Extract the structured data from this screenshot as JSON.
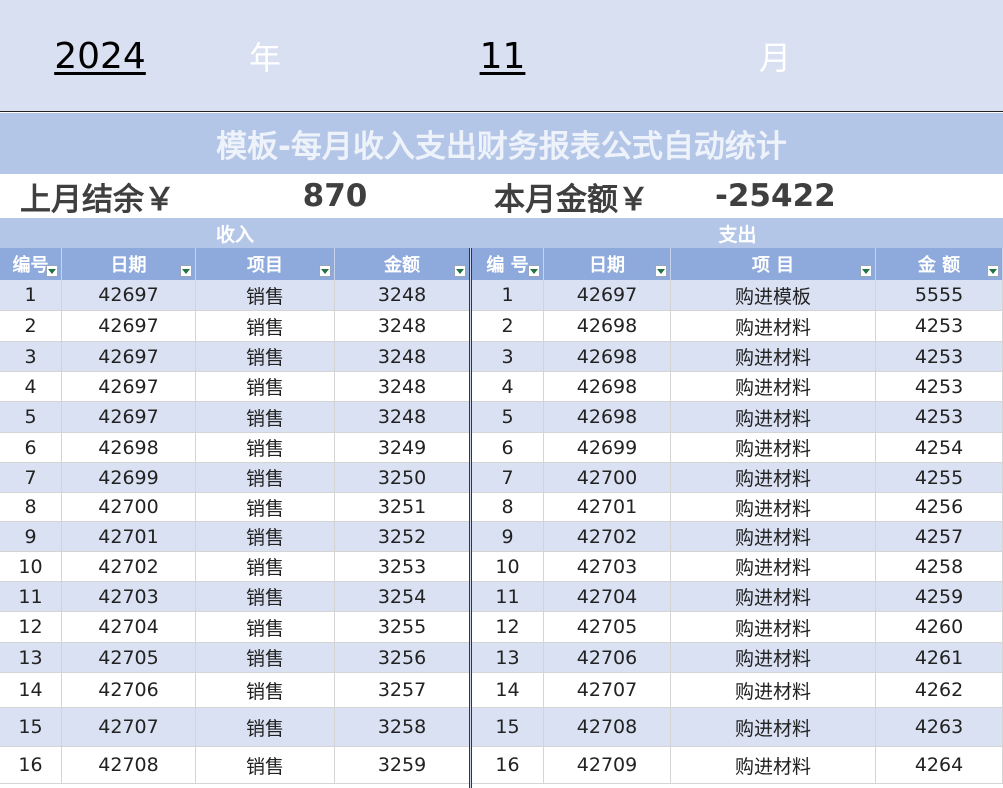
{
  "header": {
    "year": "2024",
    "year_label": "年",
    "month": "11",
    "month_label": "月"
  },
  "title": "模板-每月收入支出财务报表公式自动统计",
  "summary": {
    "last_balance_label": "上月结余￥",
    "last_balance_value": "870",
    "this_month_label": "本月金额￥",
    "this_month_value": "-25422"
  },
  "income": {
    "title": "收入",
    "headers": [
      "编号",
      "日期",
      "项目",
      "金额"
    ],
    "rows": [
      [
        "1",
        "42697",
        "销售",
        "3248"
      ],
      [
        "2",
        "42697",
        "销售",
        "3248"
      ],
      [
        "3",
        "42697",
        "销售",
        "3248"
      ],
      [
        "4",
        "42697",
        "销售",
        "3248"
      ],
      [
        "5",
        "42697",
        "销售",
        "3248"
      ],
      [
        "6",
        "42698",
        "销售",
        "3249"
      ],
      [
        "7",
        "42699",
        "销售",
        "3250"
      ],
      [
        "8",
        "42700",
        "销售",
        "3251"
      ],
      [
        "9",
        "42701",
        "销售",
        "3252"
      ],
      [
        "10",
        "42702",
        "销售",
        "3253"
      ],
      [
        "11",
        "42703",
        "销售",
        "3254"
      ],
      [
        "12",
        "42704",
        "销售",
        "3255"
      ],
      [
        "13",
        "42705",
        "销售",
        "3256"
      ],
      [
        "14",
        "42706",
        "销售",
        "3257"
      ],
      [
        "15",
        "42707",
        "销售",
        "3258"
      ],
      [
        "16",
        "42708",
        "销售",
        "3259"
      ]
    ]
  },
  "expense": {
    "title": "支出",
    "headers": [
      "编 号",
      "日期",
      "项 目",
      "金 额"
    ],
    "rows": [
      [
        "1",
        "42697",
        "购进模板",
        "5555"
      ],
      [
        "2",
        "42698",
        "购进材料",
        "4253"
      ],
      [
        "3",
        "42698",
        "购进材料",
        "4253"
      ],
      [
        "4",
        "42698",
        "购进材料",
        "4253"
      ],
      [
        "5",
        "42698",
        "购进材料",
        "4253"
      ],
      [
        "6",
        "42699",
        "购进材料",
        "4254"
      ],
      [
        "7",
        "42700",
        "购进材料",
        "4255"
      ],
      [
        "8",
        "42701",
        "购进材料",
        "4256"
      ],
      [
        "9",
        "42702",
        "购进材料",
        "4257"
      ],
      [
        "10",
        "42703",
        "购进材料",
        "4258"
      ],
      [
        "11",
        "42704",
        "购进材料",
        "4259"
      ],
      [
        "12",
        "42705",
        "购进材料",
        "4260"
      ],
      [
        "13",
        "42706",
        "购进材料",
        "4261"
      ],
      [
        "14",
        "42707",
        "购进材料",
        "4262"
      ],
      [
        "15",
        "42708",
        "购进材料",
        "4263"
      ],
      [
        "16",
        "42709",
        "购进材料",
        "4264"
      ]
    ]
  },
  "colors": {
    "band": "#d9e1f2",
    "header": "#8ea9db",
    "title_band": "#b4c6e7"
  }
}
